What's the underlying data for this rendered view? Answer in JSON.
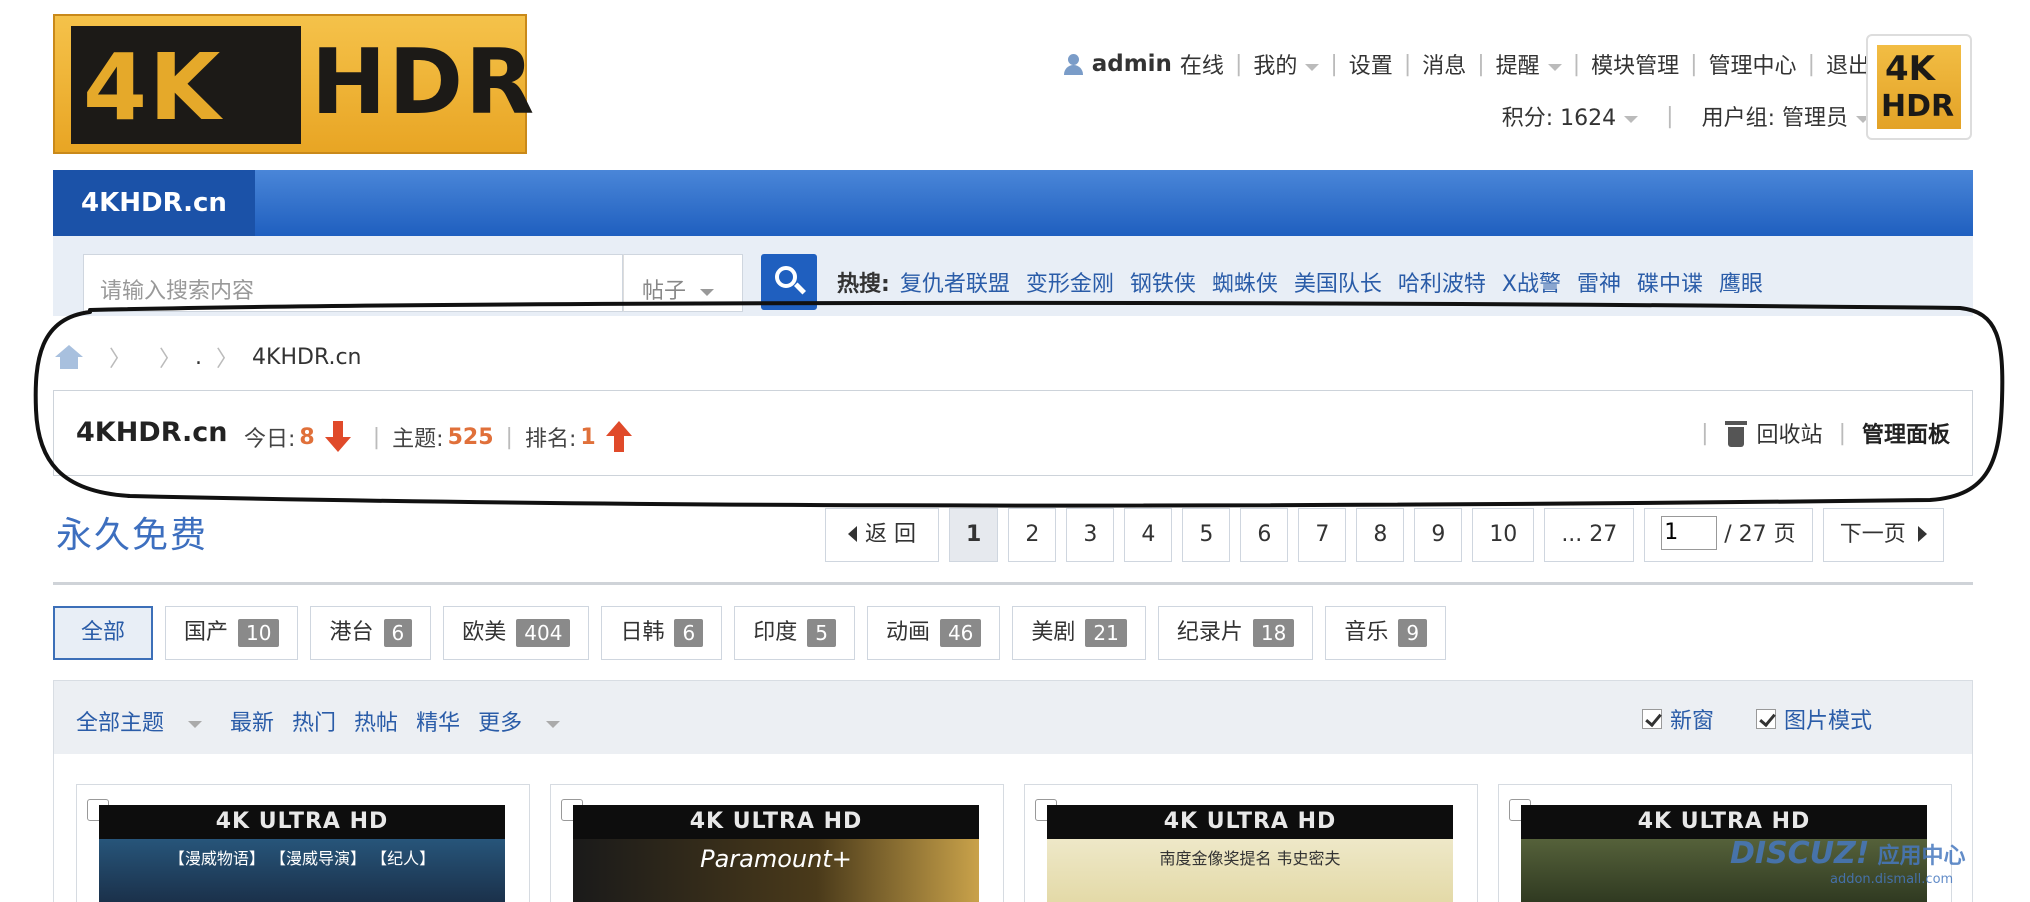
{
  "logo": {
    "left": "4K",
    "right": "HDR"
  },
  "mini_logo": {
    "line1": "4K",
    "line2": "HDR"
  },
  "topnav": {
    "username": "admin",
    "status": "在线",
    "items": [
      "我的",
      "设置",
      "消息",
      "提醒",
      "模块管理",
      "管理中心",
      "退出"
    ],
    "credits": "积分: 1624",
    "usergroup": "用户组: 管理员"
  },
  "navbar": {
    "home": "4KHDR.cn"
  },
  "search": {
    "placeholder": "请输入搜索内容",
    "type": "帖子",
    "hot_label": "热搜:",
    "hot": [
      "复仇者联盟",
      "变形金刚",
      "钢铁侠",
      "蜘蛛侠",
      "美国队长",
      "哈利波特",
      "X战警",
      "雷神",
      "碟中谍",
      "鹰眼"
    ]
  },
  "breadcrumb": {
    "dot": ".",
    "current": "4KHDR.cn"
  },
  "forum": {
    "name": "4KHDR.cn",
    "today_label": "今日:",
    "today": "8",
    "topics_label": "主题:",
    "topics": "525",
    "rank_label": "排名:",
    "rank": "1",
    "recycle": "回收站",
    "admin_panel": "管理面板"
  },
  "free_label": "永久免费",
  "pagination": {
    "back": "返 回",
    "pages": [
      "1",
      "2",
      "3",
      "4",
      "5",
      "6",
      "7",
      "8",
      "9",
      "10",
      "... 27"
    ],
    "current": "1",
    "jump_value": "1",
    "total": "/ 27 页",
    "next": "下一页"
  },
  "categories": [
    {
      "label": "全部",
      "count": ""
    },
    {
      "label": "国产",
      "count": "10"
    },
    {
      "label": "港台",
      "count": "6"
    },
    {
      "label": "欧美",
      "count": "404"
    },
    {
      "label": "日韩",
      "count": "6"
    },
    {
      "label": "印度",
      "count": "5"
    },
    {
      "label": "动画",
      "count": "46"
    },
    {
      "label": "美剧",
      "count": "21"
    },
    {
      "label": "纪录片",
      "count": "18"
    },
    {
      "label": "音乐",
      "count": "9"
    }
  ],
  "filters": {
    "all_topics": "全部主题",
    "latest": "最新",
    "hot": "热门",
    "hot_posts": "热帖",
    "digest": "精华",
    "more": "更多",
    "new_window": "新窗",
    "image_mode": "图片模式"
  },
  "posters": [
    {
      "badge": "4K ULTRA HD",
      "caption": "【漫威物语】   【漫威导演】   【纪人】",
      "color": "#1d3a5a"
    },
    {
      "badge": "4K ULTRA HD",
      "caption": "Paramount+",
      "color": "#2b2414"
    },
    {
      "badge": "4K ULTRA HD",
      "caption": "南度金像奖提名 韦史密夫",
      "color": "#e9e4c4"
    },
    {
      "badge": "4K ULTRA HD",
      "caption": "",
      "color": "#3d4a2a"
    }
  ],
  "watermark": {
    "brand": "DISCUZ!",
    "suffix": "应用中心",
    "url": "addon.dismall.com"
  }
}
